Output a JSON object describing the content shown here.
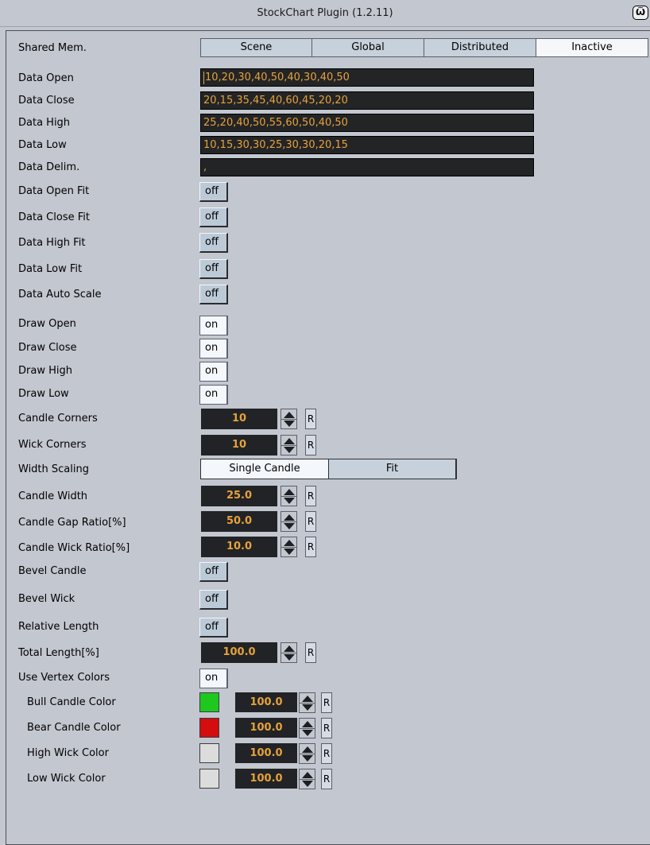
{
  "window": {
    "title": "StockChart Plugin (1.2.11)",
    "icon": "plugin-icon"
  },
  "shared_mem": {
    "label": "Shared Mem.",
    "options": [
      "Scene",
      "Global",
      "Distributed",
      "Inactive"
    ],
    "selected": "Inactive"
  },
  "data_fields": [
    {
      "label": "Data Open",
      "value": "10,20,30,40,50,40,30,40,50"
    },
    {
      "label": "Data Close",
      "value": "20,15,35,45,40,60,45,20,20"
    },
    {
      "label": "Data High",
      "value": "25,20,40,50,55,60,50,40,50"
    },
    {
      "label": "Data Low",
      "value": "10,15,30,30,25,30,30,20,15"
    },
    {
      "label": "Data Delim.",
      "value": ","
    }
  ],
  "toggles_a": [
    {
      "label": "Data Open Fit",
      "value": "off"
    },
    {
      "label": "Data Close Fit",
      "value": "off"
    },
    {
      "label": "Data High Fit",
      "value": "off"
    },
    {
      "label": "Data Low Fit",
      "value": "off"
    },
    {
      "label": "Data Auto Scale",
      "value": "off"
    }
  ],
  "toggles_b": [
    {
      "label": "Draw Open",
      "value": "on"
    },
    {
      "label": "Draw Close",
      "value": "on"
    },
    {
      "label": "Draw High",
      "value": "on"
    },
    {
      "label": "Draw Low",
      "value": "on"
    }
  ],
  "corners": [
    {
      "label": "Candle Corners",
      "value": "10",
      "reset": "R"
    },
    {
      "label": "Wick Corners",
      "value": "10",
      "reset": "R"
    }
  ],
  "width_scaling": {
    "label": "Width Scaling",
    "options": [
      "Single Candle",
      "Fit"
    ],
    "selected": "Single Candle"
  },
  "candle_params": [
    {
      "label": "Candle Width",
      "value": "25.0",
      "reset": "R"
    },
    {
      "label": "Candle Gap Ratio[%]",
      "value": "50.0",
      "reset": "R"
    },
    {
      "label": "Candle Wick Ratio[%]",
      "value": "10.0",
      "reset": "R"
    }
  ],
  "toggles_c": [
    {
      "label": "Bevel Candle",
      "value": "off"
    },
    {
      "label": "Bevel Wick",
      "value": "off"
    },
    {
      "label": "Relative Length",
      "value": "off"
    }
  ],
  "total_length": {
    "label": "Total Length[%]",
    "value": "100.0",
    "reset": "R"
  },
  "vertex_colors": {
    "label": "Use Vertex Colors",
    "value": "on"
  },
  "colors": [
    {
      "label": "Bull Candle Color",
      "color": "#1ec81e",
      "value": "100.0",
      "reset": "R"
    },
    {
      "label": "Bear Candle Color",
      "color": "#d40d0d",
      "value": "100.0",
      "reset": "R"
    },
    {
      "label": "High Wick Color",
      "color": "#dcdcdc",
      "value": "100.0",
      "reset": "R"
    },
    {
      "label": "Low Wick Color",
      "color": "#dcdcdc",
      "value": "100.0",
      "reset": "R"
    }
  ]
}
